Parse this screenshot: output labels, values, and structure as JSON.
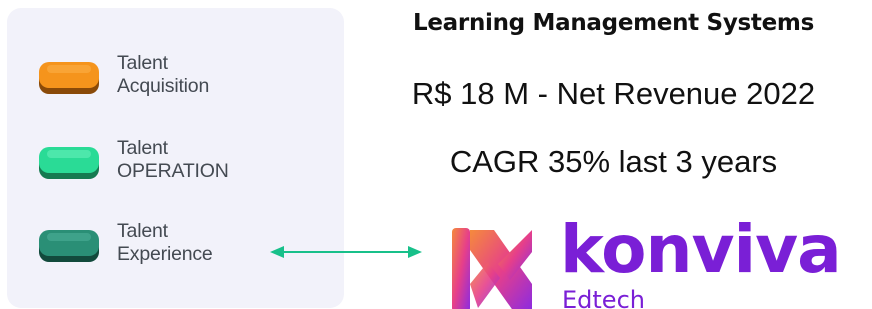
{
  "panel": {
    "items": [
      {
        "line1": "Talent",
        "line2": "Acquisition",
        "icon": "orange-block-icon",
        "color": "#f28a14"
      },
      {
        "line1": "Talent",
        "line2": "OPERATION",
        "icon": "green-block-icon",
        "color": "#27d690"
      },
      {
        "line1": "Talent",
        "line2": "Experience",
        "icon": "teal-block-icon",
        "color": "#2a8b72"
      }
    ]
  },
  "arrow": {
    "color": "#18c08a"
  },
  "info": {
    "title": "Learning Management Systems",
    "revenue": "R$ 18 M - Net Revenue 2022",
    "cagr": "CAGR 35% last 3 years"
  },
  "logo": {
    "name": "konviva",
    "sub": "Edtech",
    "color": "#7a1fd6"
  }
}
